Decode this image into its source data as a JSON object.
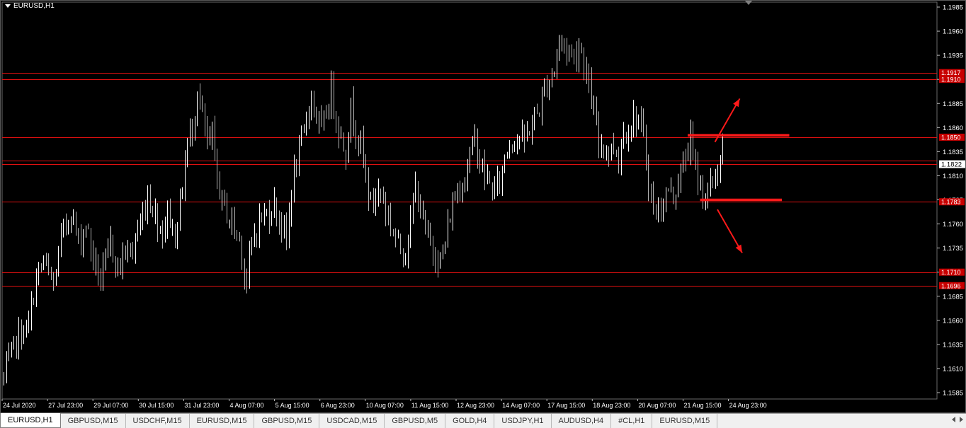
{
  "window": {
    "title": "EURUSD,H1"
  },
  "colors": {
    "background": "#000000",
    "foreground": "#ffffff",
    "candle_up": "#ffffff",
    "candle_down": "#b4b4b4",
    "levels": "#e01010",
    "trend": "#ff1a1a",
    "current_price_bg": "#ffffff"
  },
  "tabs": [
    {
      "label": "EURUSD,H1",
      "active": true
    },
    {
      "label": "GBPUSD,M15",
      "active": false
    },
    {
      "label": "USDCHF,M15",
      "active": false
    },
    {
      "label": "EURUSD,M15",
      "active": false
    },
    {
      "label": "GBPUSD,M15",
      "active": false
    },
    {
      "label": "USDCAD,M15",
      "active": false
    },
    {
      "label": "GBPUSD,M5",
      "active": false
    },
    {
      "label": "GOLD,H4",
      "active": false
    },
    {
      "label": "USDJPY,H1",
      "active": false
    },
    {
      "label": "AUDUSD,H4",
      "active": false
    },
    {
      "label": "#CL,H1",
      "active": false
    },
    {
      "label": "EURUSD,M15",
      "active": false
    }
  ],
  "chart_data": {
    "type": "candlestick",
    "symbol": "EURUSD",
    "timeframe": "H1",
    "ylim": [
      1.1585,
      1.1985
    ],
    "y_ticks": [
      "1.1985",
      "1.1960",
      "1.1935",
      "1.1910",
      "1.1885",
      "1.1860",
      "1.1835",
      "1.1810",
      "1.1785",
      "1.1760",
      "1.1735",
      "1.1710",
      "1.1685",
      "1.1660",
      "1.1635",
      "1.1610",
      "1.1585"
    ],
    "x_ticks": [
      "24 Jul 2020",
      "27 Jul 23:00",
      "29 Jul 07:00",
      "30 Jul 15:00",
      "31 Jul 23:00",
      "4 Aug 07:00",
      "5 Aug 15:00",
      "6 Aug 23:00",
      "10 Aug 07:00",
      "11 Aug 15:00",
      "12 Aug 23:00",
      "14 Aug 07:00",
      "17 Aug 15:00",
      "18 Aug 23:00",
      "20 Aug 07:00",
      "21 Aug 15:00",
      "24 Aug 23:00"
    ],
    "current_price": "1.1822",
    "levels": [
      {
        "price": 1.1917,
        "label": "1.1917"
      },
      {
        "price": 1.191,
        "label": "1.1910"
      },
      {
        "price": 1.185,
        "label": "1.1850"
      },
      {
        "price": 1.1826,
        "label": ""
      },
      {
        "price": 1.1822,
        "label": ""
      },
      {
        "price": 1.1783,
        "label": "1.1783"
      },
      {
        "price": 1.171,
        "label": "1.1710"
      },
      {
        "price": 1.1696,
        "label": "1.1696"
      }
    ],
    "path_points": [
      [
        0,
        1.16
      ],
      [
        5,
        1.164
      ],
      [
        10,
        1.1655
      ],
      [
        13,
        1.1705
      ],
      [
        16,
        1.172
      ],
      [
        20,
        1.1695
      ],
      [
        23,
        1.1745
      ],
      [
        27,
        1.1775
      ],
      [
        30,
        1.174
      ],
      [
        33,
        1.176
      ],
      [
        36,
        1.1725
      ],
      [
        39,
        1.17
      ],
      [
        43,
        1.174
      ],
      [
        46,
        1.1715
      ],
      [
        49,
        1.173
      ],
      [
        52,
        1.1735
      ],
      [
        55,
        1.176
      ],
      [
        58,
        1.179
      ],
      [
        61,
        1.177
      ],
      [
        64,
        1.175
      ],
      [
        66,
        1.1775
      ],
      [
        69,
        1.1745
      ],
      [
        72,
        1.18
      ],
      [
        74,
        1.1845
      ],
      [
        76,
        1.186
      ],
      [
        78,
        1.19
      ],
      [
        80,
        1.187
      ],
      [
        82,
        1.184
      ],
      [
        84,
        1.185
      ],
      [
        86,
        1.1805
      ],
      [
        88,
        1.1785
      ],
      [
        90,
        1.177
      ],
      [
        92,
        1.176
      ],
      [
        95,
        1.1745
      ],
      [
        97,
        1.171
      ],
      [
        98,
        1.17
      ],
      [
        100,
        1.174
      ],
      [
        103,
        1.1765
      ],
      [
        106,
        1.177
      ],
      [
        109,
        1.178
      ],
      [
        112,
        1.176
      ],
      [
        114,
        1.174
      ],
      [
        116,
        1.18
      ],
      [
        118,
        1.182
      ],
      [
        120,
        1.1845
      ],
      [
        122,
        1.187
      ],
      [
        124,
        1.1895
      ],
      [
        126,
        1.187
      ],
      [
        128,
        1.1855
      ],
      [
        130,
        1.1875
      ],
      [
        132,
        1.19
      ],
      [
        134,
        1.187
      ],
      [
        136,
        1.185
      ],
      [
        138,
        1.1835
      ],
      [
        140,
        1.188
      ],
      [
        142,
        1.186
      ],
      [
        144,
        1.184
      ],
      [
        146,
        1.181
      ],
      [
        148,
        1.178
      ],
      [
        150,
        1.179
      ],
      [
        152,
        1.1795
      ],
      [
        154,
        1.1775
      ],
      [
        156,
        1.176
      ],
      [
        158,
        1.1745
      ],
      [
        160,
        1.1735
      ],
      [
        162,
        1.1735
      ],
      [
        164,
        1.176
      ],
      [
        166,
        1.18
      ],
      [
        168,
        1.1775
      ],
      [
        170,
        1.175
      ],
      [
        172,
        1.174
      ],
      [
        174,
        1.173
      ],
      [
        176,
        1.172
      ],
      [
        178,
        1.174
      ],
      [
        180,
        1.177
      ],
      [
        182,
        1.179
      ],
      [
        184,
        1.18
      ],
      [
        186,
        1.181
      ],
      [
        188,
        1.183
      ],
      [
        190,
        1.185
      ],
      [
        192,
        1.1825
      ],
      [
        194,
        1.181
      ],
      [
        196,
        1.18
      ],
      [
        198,
        1.1795
      ],
      [
        200,
        1.1805
      ],
      [
        202,
        1.183
      ],
      [
        204,
        1.1845
      ],
      [
        206,
        1.185
      ],
      [
        208,
        1.185
      ],
      [
        210,
        1.1845
      ],
      [
        212,
        1.186
      ],
      [
        214,
        1.187
      ],
      [
        216,
        1.188
      ],
      [
        218,
        1.19
      ],
      [
        220,
        1.191
      ],
      [
        222,
        1.192
      ],
      [
        223,
        1.194
      ],
      [
        224,
        1.195
      ],
      [
        226,
        1.1945
      ],
      [
        228,
        1.194
      ],
      [
        230,
        1.1935
      ],
      [
        232,
        1.1945
      ],
      [
        234,
        1.193
      ],
      [
        236,
        1.19
      ],
      [
        238,
        1.1875
      ],
      [
        240,
        1.184
      ],
      [
        242,
        1.1845
      ],
      [
        244,
        1.1835
      ],
      [
        246,
        1.184
      ],
      [
        248,
        1.183
      ],
      [
        250,
        1.1855
      ],
      [
        252,
        1.186
      ],
      [
        254,
        1.187
      ],
      [
        256,
        1.187
      ],
      [
        258,
        1.1845
      ],
      [
        260,
        1.1805
      ],
      [
        262,
        1.1775
      ],
      [
        264,
        1.177
      ],
      [
        266,
        1.1785
      ],
      [
        268,
        1.1795
      ],
      [
        270,
        1.179
      ],
      [
        272,
        1.1805
      ],
      [
        274,
        1.182
      ],
      [
        276,
        1.184
      ],
      [
        277,
        1.185
      ],
      [
        278,
        1.183
      ],
      [
        280,
        1.1805
      ],
      [
        282,
        1.1795
      ],
      [
        284,
        1.179
      ],
      [
        286,
        1.1805
      ],
      [
        288,
        1.1815
      ],
      [
        290,
        1.1835
      ]
    ],
    "trend_lines": [
      {
        "from": [
          276,
          1.1852
        ],
        "to": [
          317,
          1.1852
        ]
      },
      {
        "from": [
          281,
          1.1785
        ],
        "to": [
          314,
          1.1785
        ]
      }
    ],
    "trend_arrows": [
      {
        "from": [
          287,
          1.1845
        ],
        "to": [
          297,
          1.189
        ]
      },
      {
        "from": [
          288,
          1.1775
        ],
        "to": [
          298,
          1.173
        ]
      }
    ]
  }
}
